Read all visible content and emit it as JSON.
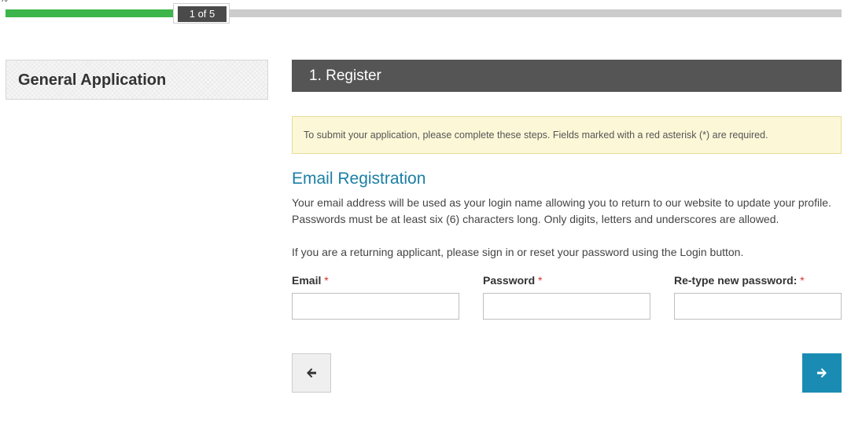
{
  "progress": {
    "badge": "1 of 5",
    "fraction": 0.2,
    "corner_glyph": "%",
    "colors": {
      "fill": "#3cb54a",
      "track": "#cccccc"
    }
  },
  "sidebar": {
    "title": "General Application"
  },
  "step": {
    "title": "1. Register"
  },
  "notice": {
    "text": "To submit your application, please complete these steps. Fields marked with a red asterisk (*) are required."
  },
  "section": {
    "heading": "Email Registration",
    "paragraph1": "Your email address will be used as your login name allowing you to return to our website to update your profile. Passwords must be at least six (6) characters long. Only digits, letters and underscores are allowed.",
    "paragraph2": "If you are a returning applicant, please sign in or reset your password using the Login button."
  },
  "form": {
    "required_marker": "*",
    "fields": [
      {
        "label": "Email",
        "value": "",
        "placeholder": ""
      },
      {
        "label": "Password",
        "value": "",
        "placeholder": ""
      },
      {
        "label": "Re-type new password:",
        "value": "",
        "placeholder": ""
      }
    ]
  },
  "nav": {
    "back_icon": "arrow-left-icon",
    "next_icon": "arrow-right-icon",
    "colors": {
      "next": "#1a8cb3",
      "back": "#efefef"
    }
  }
}
